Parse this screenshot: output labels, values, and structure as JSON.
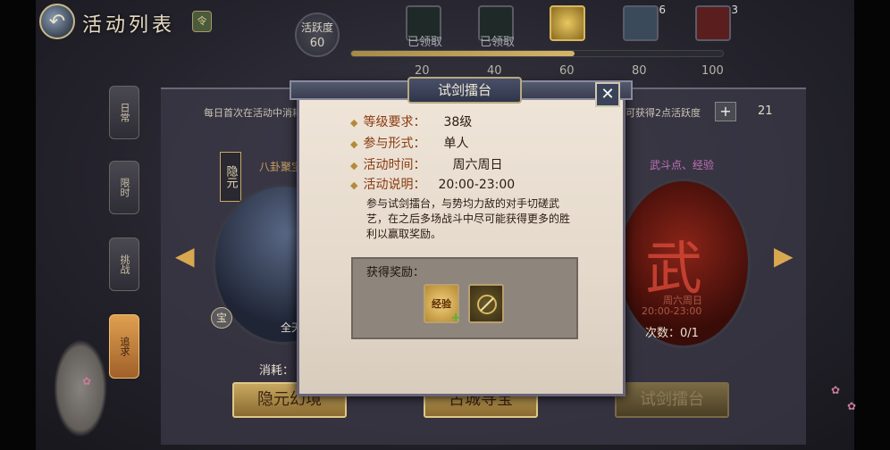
{
  "header": {
    "back_icon": "back-arrow-icon",
    "title": "活动列表",
    "badge": "令"
  },
  "activity": {
    "label": "活跃度",
    "value": "60",
    "progress_fraction": 0.6,
    "ticks": [
      "20",
      "40",
      "60",
      "80",
      "100"
    ],
    "rewards": [
      {
        "status": "已领取",
        "count": ""
      },
      {
        "status": "已领取",
        "count": ""
      },
      {
        "status": "",
        "count": ""
      },
      {
        "status": "",
        "count": "6"
      },
      {
        "status": "",
        "count": "3"
      }
    ]
  },
  "panel": {
    "info_left": "每日首次在活动中消耗",
    "info_right": "可获得2点活跃度",
    "plus": "+",
    "coins": "21"
  },
  "side_tabs": [
    "日常",
    "限时",
    "挑战",
    "追求"
  ],
  "cards": {
    "left_tag": "隐元",
    "left_subtitle": "八卦聚宝",
    "left_time": "全天",
    "left_round": "宝",
    "consume_label": "消耗：",
    "right_subtitle": "武斗点、经验",
    "right_days": "周六周日",
    "right_time": "20:00-23:00",
    "right_count": "次数：0/1",
    "fight_char": "武",
    "btn_left": "隐元幻境",
    "btn_mid": "古城寻宝",
    "btn_right": "试剑擂台"
  },
  "modal": {
    "title": "试剑擂台",
    "close": "✕",
    "level_label": "等级要求：",
    "level_value": "38级",
    "form_label": "参与形式：",
    "form_value": "单人",
    "time_label": "活动时间：",
    "time_days": "周六周日",
    "time_hours": "20:00-23:00",
    "desc_label": "活动说明：",
    "desc_text": "参与试剑擂台，与势均力敌的对手切磋武艺，在之后多场战斗中尽可能获得更多的胜利以赢取奖励。",
    "reward_label": "获得奖励：",
    "reward_exp_text": "经验",
    "reward_icons": [
      "exp-reward-icon",
      "sword-reward-icon"
    ]
  }
}
